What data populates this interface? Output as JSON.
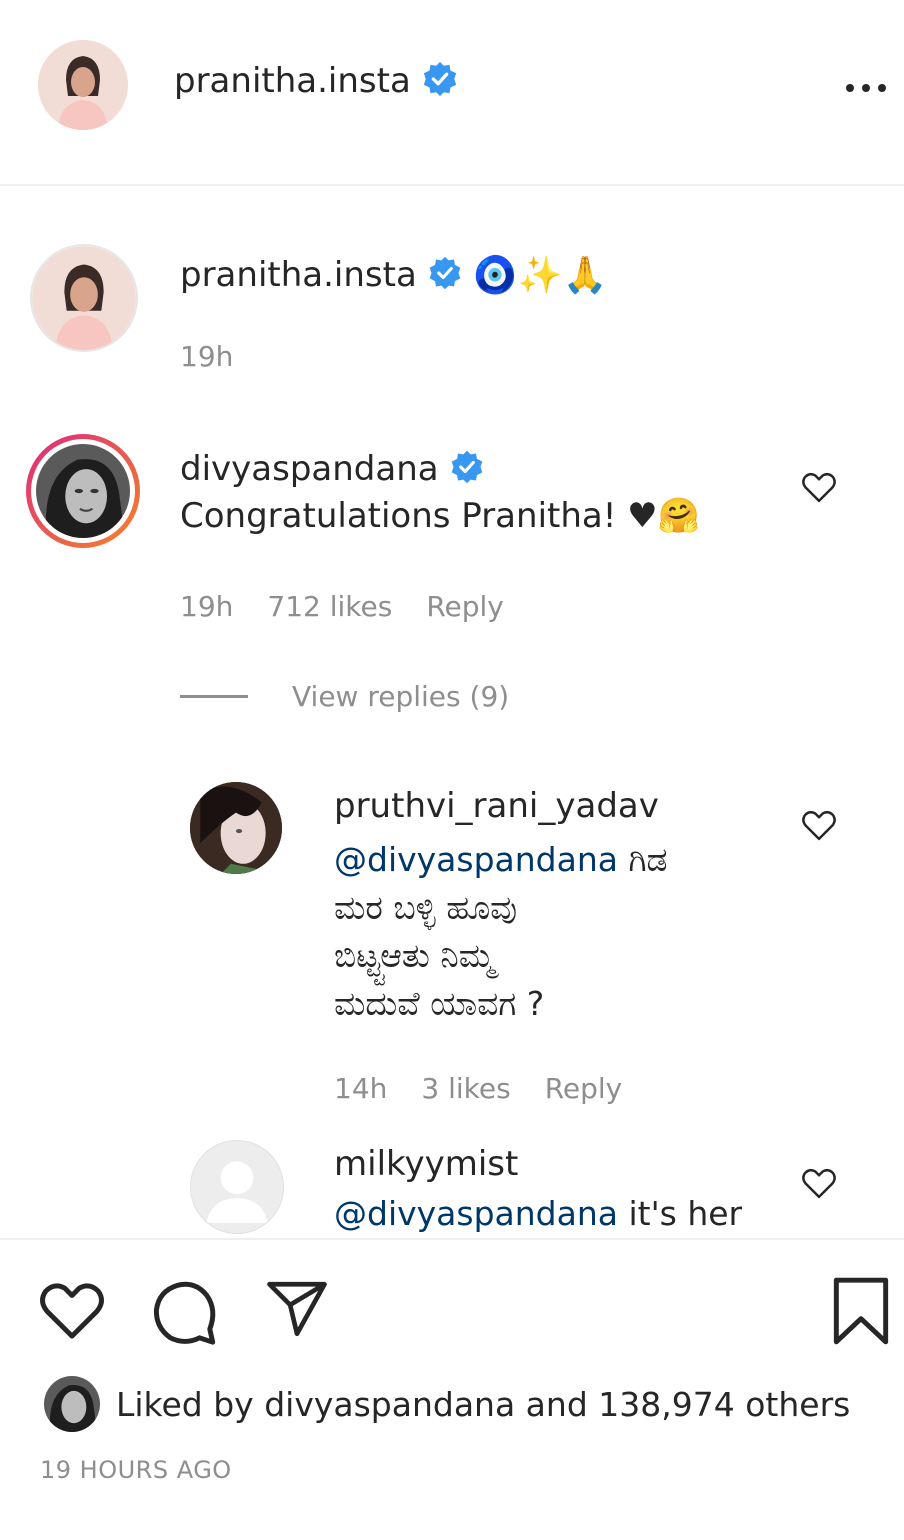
{
  "header": {
    "username": "pranitha.insta",
    "more_label": "..."
  },
  "caption": {
    "username": "pranitha.insta",
    "text": "🧿✨🙏",
    "time": "19h"
  },
  "comments": [
    {
      "username": "divyaspandana",
      "text": "Congratulations Pranitha! ♥🤗",
      "time": "19h",
      "likes": "712 likes",
      "reply_label": "Reply",
      "view_replies": "View replies (9)"
    }
  ],
  "replies": [
    {
      "username": "pruthvi_rani_yadav",
      "mention": "@divyaspandana",
      "text_line1": " ಗಿಡ",
      "text_line2": "ಮರ ಬಳ್ಳಿ ಹೂವು",
      "text_line3": "ಬಿಟ್ಟ್ಟಆತು ನಿಮ್ಮ",
      "text_line4": "ಮದುವೆ ಯಾವಗ ?",
      "time": "14h",
      "likes": "3 likes",
      "reply_label": "Reply"
    },
    {
      "username": "milkyymist",
      "mention": "@divyaspandana",
      "text": " it's her"
    }
  ],
  "actions": {
    "liked_by_prefix": "Liked by ",
    "liked_by_user": "divyaspandana",
    "liked_by_and": " and ",
    "liked_by_count": "138,974 others",
    "timestamp": "19 HOURS AGO"
  },
  "colors": {
    "verified": "#3897f0",
    "story_ring_start": "#f58529",
    "story_ring_end": "#dd2a7b",
    "muted": "#8e8e8e",
    "mention": "#00376b"
  }
}
